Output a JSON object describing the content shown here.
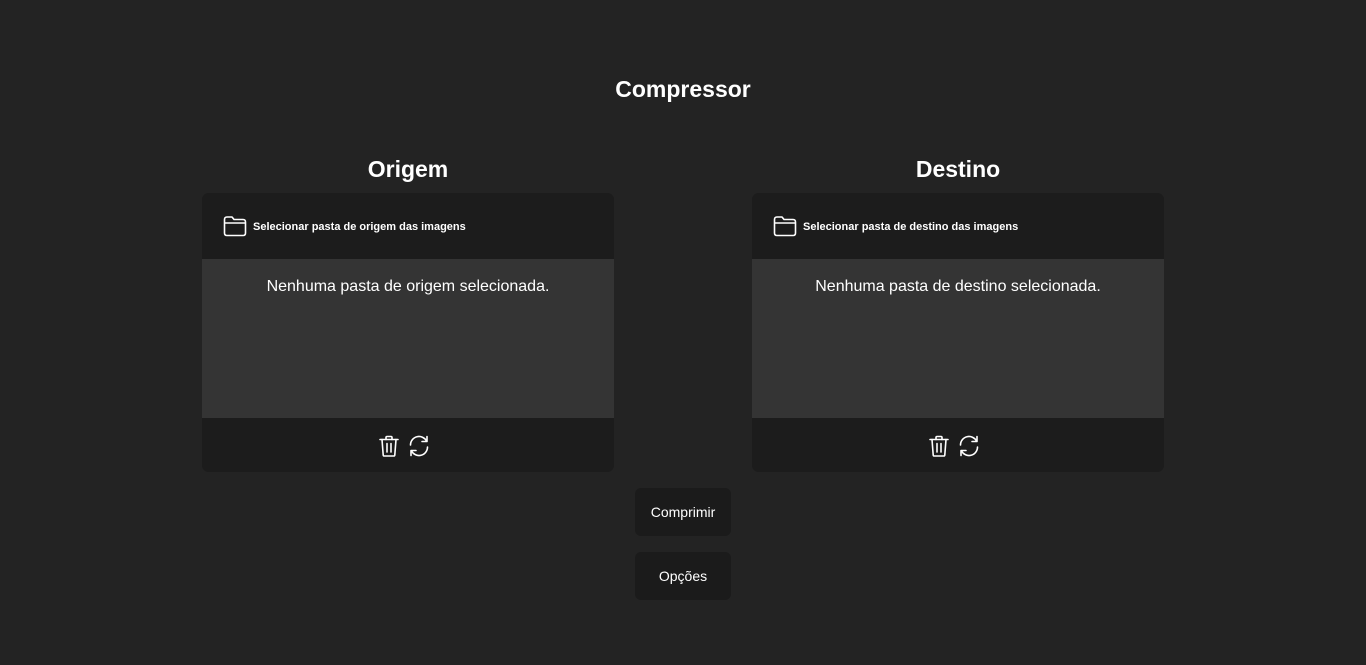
{
  "app": {
    "title": "Compressor"
  },
  "source": {
    "heading": "Origem",
    "select_label": "Selecionar pasta de origem das imagens",
    "empty_message": "Nenhuma pasta de origem selecionada.",
    "icons": {
      "folder": "folder-icon",
      "clear": "trash-icon",
      "refresh": "refresh-icon"
    }
  },
  "destination": {
    "heading": "Destino",
    "select_label": "Selecionar pasta de destino das imagens",
    "empty_message": "Nenhuma pasta de destino selecionada.",
    "icons": {
      "folder": "folder-icon",
      "clear": "trash-icon",
      "refresh": "refresh-icon"
    }
  },
  "actions": {
    "compress_label": "Comprimir",
    "options_label": "Opções"
  },
  "colors": {
    "background": "#232323",
    "panel": "#1c1c1c",
    "panel_body": "#343434",
    "text": "#ffffff"
  }
}
